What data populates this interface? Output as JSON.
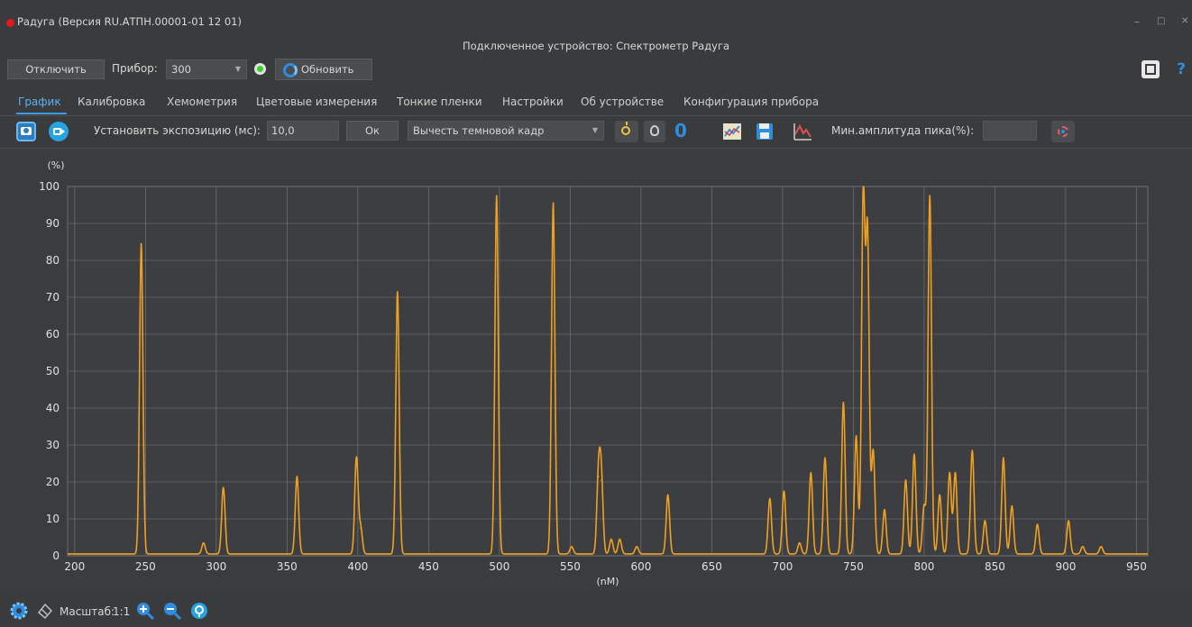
{
  "window": {
    "title": "Радуга (Версия RU.АТПН.00001-01 12 01)",
    "device_title": "Подключенное устройство: Спектрометр Радуга",
    "minimize": "–",
    "maximize": "□",
    "close": "✕"
  },
  "toolbar": {
    "disconnect_label": "Отключить",
    "device_label": "Прибор:",
    "device_value": "300",
    "refresh_label": "Обновить"
  },
  "tabs": [
    {
      "label": "График"
    },
    {
      "label": "Калибровка"
    },
    {
      "label": "Хемометрия"
    },
    {
      "label": "Цветовые измерения"
    },
    {
      "label": "Тонкие пленки"
    },
    {
      "label": "Настройки"
    },
    {
      "label": "Об устройстве"
    },
    {
      "label": "Конфигурация прибора"
    }
  ],
  "graph_toolbar": {
    "exposure_label": "Установить экспозицию (мс):",
    "exposure_value": "10,0",
    "ok_label": "Ок",
    "dark_frame_value": "Вычесть темновой кадр",
    "zero_label": "0",
    "min_amp_label": "Мин.амплитуда пика(%):",
    "min_amp_value": ""
  },
  "statusbar": {
    "scale_label": "Масштаб:",
    "scale_value": "1:1"
  },
  "colors": {
    "accent": "#3a9be8",
    "series": "#f0a020",
    "background": "#3a3b3d"
  },
  "chart_data": {
    "type": "line",
    "title": "",
    "xlabel": "(nM)",
    "ylabel": "(%)",
    "xlim": [
      195,
      958
    ],
    "ylim": [
      0,
      100
    ],
    "x_ticks": [
      200,
      250,
      300,
      350,
      400,
      450,
      500,
      550,
      600,
      650,
      700,
      750,
      800,
      850,
      900,
      950
    ],
    "y_ticks": [
      0,
      10,
      20,
      30,
      40,
      50,
      60,
      70,
      80,
      90,
      100
    ],
    "grid": true,
    "series": [
      {
        "name": "",
        "baseline": 0.5,
        "peaks": [
          {
            "x": 247,
            "y": 84
          },
          {
            "x": 291,
            "y": 3
          },
          {
            "x": 305,
            "y": 18
          },
          {
            "x": 357,
            "y": 21
          },
          {
            "x": 399,
            "y": 26
          },
          {
            "x": 402,
            "y": 7
          },
          {
            "x": 428,
            "y": 71
          },
          {
            "x": 498,
            "y": 97
          },
          {
            "x": 538,
            "y": 95
          },
          {
            "x": 551,
            "y": 2
          },
          {
            "x": 570,
            "y": 21
          },
          {
            "x": 572,
            "y": 20
          },
          {
            "x": 579,
            "y": 4
          },
          {
            "x": 585,
            "y": 4
          },
          {
            "x": 597,
            "y": 2
          },
          {
            "x": 619,
            "y": 16
          },
          {
            "x": 691,
            "y": 15
          },
          {
            "x": 701,
            "y": 17
          },
          {
            "x": 712,
            "y": 3
          },
          {
            "x": 720,
            "y": 22
          },
          {
            "x": 730,
            "y": 26
          },
          {
            "x": 743,
            "y": 41
          },
          {
            "x": 752,
            "y": 32
          },
          {
            "x": 757,
            "y": 97
          },
          {
            "x": 760,
            "y": 86
          },
          {
            "x": 764,
            "y": 28
          },
          {
            "x": 772,
            "y": 12
          },
          {
            "x": 787,
            "y": 20
          },
          {
            "x": 793,
            "y": 27
          },
          {
            "x": 800,
            "y": 13
          },
          {
            "x": 804,
            "y": 97
          },
          {
            "x": 811,
            "y": 16
          },
          {
            "x": 818,
            "y": 22
          },
          {
            "x": 822,
            "y": 22
          },
          {
            "x": 834,
            "y": 28
          },
          {
            "x": 843,
            "y": 9
          },
          {
            "x": 856,
            "y": 26
          },
          {
            "x": 862,
            "y": 13
          },
          {
            "x": 880,
            "y": 8
          },
          {
            "x": 902,
            "y": 9
          },
          {
            "x": 912,
            "y": 2
          },
          {
            "x": 925,
            "y": 2
          }
        ]
      }
    ]
  }
}
